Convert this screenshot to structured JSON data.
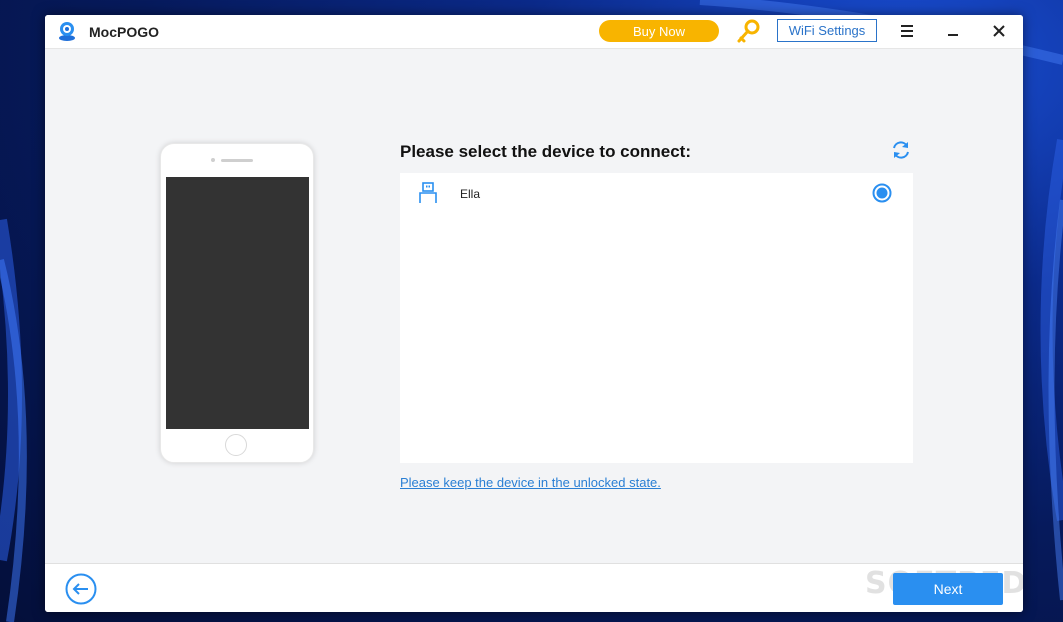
{
  "app": {
    "title": "MocPOGO",
    "buy_now_label": "Buy Now",
    "wifi_settings_label": "WiFi Settings"
  },
  "main": {
    "heading": "Please select the device to connect:",
    "devices": [
      {
        "name": "Ella",
        "selected": true
      }
    ],
    "unlock_hint": "Please keep the device in the unlocked state."
  },
  "footer": {
    "next_label": "Next",
    "watermark": "SOFTPEDIA"
  },
  "colors": {
    "accent": "#2a8ff0",
    "buy_now": "#f8b400",
    "link": "#2a7fd4"
  },
  "icons": [
    "app-logo-icon",
    "key-icon",
    "menu-icon",
    "minimize-icon",
    "close-icon",
    "refresh-icon",
    "usb-icon",
    "radio-selected-icon",
    "back-arrow-icon"
  ]
}
